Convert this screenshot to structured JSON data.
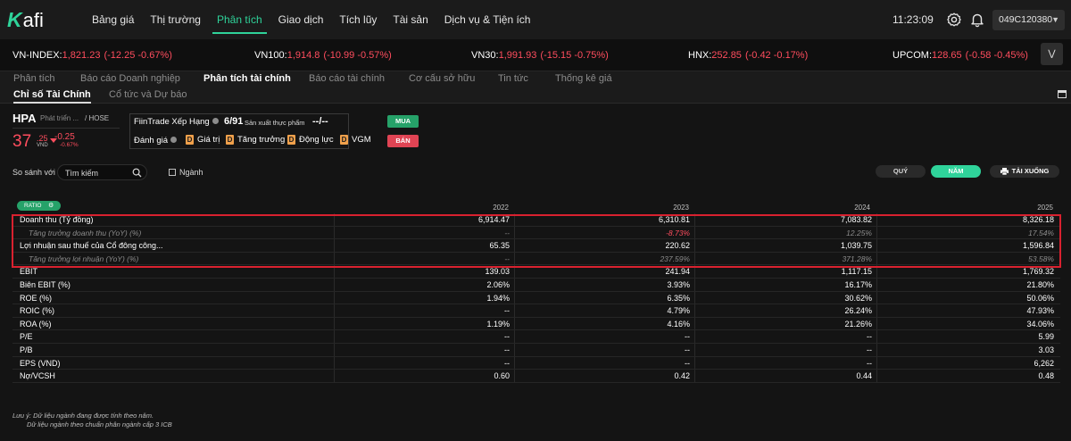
{
  "app": {
    "logo_k": "K",
    "logo_rest": "afi"
  },
  "nav": {
    "items": [
      "Bảng giá",
      "Thị trường",
      "Phân tích",
      "Giao dịch",
      "Tích lũy",
      "Tài sản",
      "Dịch vụ & Tiện ích"
    ],
    "active": "Phân tích",
    "clock": "11:23:09",
    "account": "049C120380"
  },
  "indices": [
    {
      "name": "VN-INDEX:",
      "value": "1,821.23",
      "change": "(-12.25  -0.67%)"
    },
    {
      "name": "VN100:",
      "value": "1,914.8",
      "change": "(-10.99  -0.57%)"
    },
    {
      "name": "VN30:",
      "value": "1,991.93",
      "change": "(-15.15  -0.75%)"
    },
    {
      "name": "HNX:",
      "value": "252.85",
      "change": "(-0.42  -0.17%)"
    },
    {
      "name": "UPCOM:",
      "value": "128.65",
      "change": "(-0.58  -0.45%)"
    }
  ],
  "tabs_main": [
    "Phân tích",
    "Báo cáo Doanh nghiệp",
    "Phân tích tài chính",
    "Báo cáo tài chính",
    "Cơ cấu sở hữu",
    "Tin tức",
    "Thống kê giá"
  ],
  "tabs_sub": [
    "Chỉ số Tài Chính",
    "Cổ tức và Dự báo"
  ],
  "stock": {
    "symbol": "HPA",
    "name": "Phát triển ...",
    "exchange": "/ HOSE",
    "price_int": "37",
    "price_dec": ".25",
    "unit": "VND",
    "change": "-0.25",
    "change_pct": "-0.67%"
  },
  "fintrade": {
    "rank_label": "FiinTrade Xếp Hạng",
    "rank": "6/91",
    "sector": "Sản xuất thực phẩm",
    "dash": "--/--",
    "rating_label": "Đánh giá",
    "badges": [
      {
        "grade": "D",
        "label": "Giá trị"
      },
      {
        "grade": "D",
        "label": "Tăng trưởng"
      },
      {
        "grade": "D",
        "label": "Động lực"
      },
      {
        "grade": "D",
        "label": "VGM"
      }
    ]
  },
  "actions": {
    "buy": "MUA",
    "sell": "BÁN"
  },
  "compare": {
    "label": "So sánh với",
    "search_placeholder": "Tìm kiếm",
    "sector_label": "Ngành"
  },
  "period": {
    "quarter": "QUÝ",
    "year": "NĂM",
    "download": "TẢI XUỐNG"
  },
  "table": {
    "tag": "RATIO",
    "years": [
      "2022",
      "2023",
      "2024",
      "2025"
    ],
    "rows": [
      {
        "label": "Doanh thu (Tỷ đồng)",
        "sub": false,
        "values": [
          "6,914.47",
          "6,310.81",
          "7,083.82",
          "8,326.18"
        ]
      },
      {
        "label": "Tăng trưởng doanh thu (YoY) (%)",
        "sub": true,
        "values": [
          "--",
          "-8.73%",
          "12.25%",
          "17.54%"
        ]
      },
      {
        "label": "Lợi nhuận sau thuế của Cổ đông công...",
        "sub": false,
        "values": [
          "65.35",
          "220.62",
          "1,039.75",
          "1,596.84"
        ]
      },
      {
        "label": "Tăng trưởng lợi nhuận (YoY) (%)",
        "sub": true,
        "values": [
          "--",
          "237.59%",
          "371.28%",
          "53.58%"
        ]
      },
      {
        "label": "EBIT",
        "sub": false,
        "values": [
          "139.03",
          "241.94",
          "1,117.15",
          "1,769.32"
        ]
      },
      {
        "label": "Biên EBIT (%)",
        "sub": false,
        "values": [
          "2.06%",
          "3.93%",
          "16.17%",
          "21.80%"
        ]
      },
      {
        "label": "ROE (%)",
        "sub": false,
        "values": [
          "1.94%",
          "6.35%",
          "30.62%",
          "50.06%"
        ]
      },
      {
        "label": "ROIC (%)",
        "sub": false,
        "values": [
          "--",
          "4.79%",
          "26.24%",
          "47.93%"
        ]
      },
      {
        "label": "ROA (%)",
        "sub": false,
        "values": [
          "1.19%",
          "4.16%",
          "21.26%",
          "34.06%"
        ]
      },
      {
        "label": "P/E",
        "sub": false,
        "values": [
          "--",
          "--",
          "--",
          "5.99"
        ]
      },
      {
        "label": "P/B",
        "sub": false,
        "values": [
          "--",
          "--",
          "--",
          "3.03"
        ]
      },
      {
        "label": "EPS (VND)",
        "sub": false,
        "values": [
          "--",
          "--",
          "--",
          "6,262"
        ]
      },
      {
        "label": "Nợ/VCSH",
        "sub": false,
        "values": [
          "0.60",
          "0.42",
          "0.44",
          "0.48"
        ]
      }
    ]
  },
  "footnotes": [
    "Lưu ý: Dữ liệu ngành đang được tính theo năm.",
    "Dữ liệu ngành theo chuẩn phân ngành cấp 3 ICB"
  ],
  "colors": {
    "accent": "#2fd39a",
    "down": "#ff4d5e",
    "buy": "#26a269",
    "sell": "#e04454",
    "highlight": "#d9212f"
  }
}
